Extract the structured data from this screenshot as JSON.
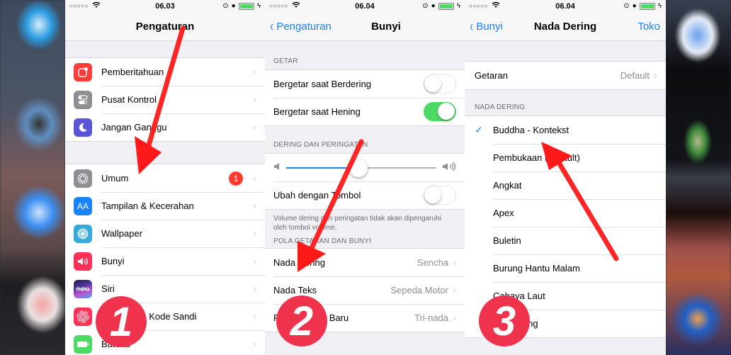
{
  "colors": {
    "ios_blue": "#1a82fb",
    "toggle_on": "#4cd964",
    "badge_red": "#ff3b30",
    "step_badge": "#f0334d",
    "arrow_red": "#ff1a1a"
  },
  "screens": [
    {
      "status": {
        "signal": "○○○○○",
        "wifi": "wifi-icon",
        "time": "06.03",
        "lock": "⊙",
        "alarm": "⏰",
        "bolt": "⚡",
        "battery_level": 1.0
      },
      "nav": {
        "title": "Pengaturan"
      },
      "groups": [
        [
          {
            "label": "Pemberitahuan",
            "icon": "notifications-icon",
            "icon_color": "#fc3d39"
          },
          {
            "label": "Pusat Kontrol",
            "icon": "control-center-icon",
            "icon_color": "#8e8e93"
          },
          {
            "label": "Jangan Ganggu",
            "icon": "do-not-disturb-icon",
            "icon_color": "#5856d6"
          }
        ],
        [
          {
            "label": "Umum",
            "icon": "gear-icon",
            "icon_color": "#8e8e93",
            "badge": "1"
          },
          {
            "label": "Tampilan & Kecerahan",
            "icon": "display-brightness-icon",
            "icon_color": "#1a82fb",
            "icon_text": "AA"
          },
          {
            "label": "Wallpaper",
            "icon": "wallpaper-icon",
            "icon_color": "#35aadc"
          },
          {
            "label": "Bunyi",
            "icon": "sound-icon",
            "icon_color": "#fc3158"
          },
          {
            "label": "Siri",
            "icon": "siri-icon",
            "icon_color": "#2a2a5a"
          },
          {
            "label": "Touch ID & Kode Sandi",
            "icon": "fingerprint-icon",
            "icon_color": "#fc3158"
          },
          {
            "label": "Baterai",
            "icon": "battery-icon",
            "icon_color": "#4cd964"
          }
        ]
      ],
      "step": "1"
    },
    {
      "status": {
        "signal": "○○○○○",
        "wifi": "wifi-icon",
        "time": "06.04",
        "lock": "⊙",
        "alarm": "⏰",
        "bolt": "⚡",
        "battery_level": 1.0
      },
      "nav": {
        "back": "Pengaturan",
        "title": "Bunyi"
      },
      "sections": {
        "getar": {
          "header": "GETAR",
          "rows": [
            {
              "label": "Bergetar saat Berdering",
              "on": false
            },
            {
              "label": "Bergetar saat Hening",
              "on": true
            }
          ]
        },
        "dering": {
          "header": "DERING DAN PERINGATAN",
          "volume": 0.48,
          "toggle_row": {
            "label": "Ubah dengan Tombol",
            "on": false
          },
          "footer": "Volume dering dan peringatan tidak akan dipengaruhi oleh tombol volume."
        },
        "pola": {
          "header": "POLA GETARAN DAN BUNYI",
          "rows": [
            {
              "label": "Nada Dering",
              "value": "Sencha"
            },
            {
              "label": "Nada Teks",
              "value": "Sepeda Motor"
            },
            {
              "label": "Pesan Suara Baru",
              "value": "Tri-nada"
            }
          ]
        }
      },
      "step": "2"
    },
    {
      "status": {
        "signal": "○○○○○",
        "wifi": "wifi-icon",
        "time": "06.04",
        "lock": "⊙",
        "alarm": "⏰",
        "bolt": "⚡",
        "battery_level": 1.0
      },
      "nav": {
        "back": "Bunyi",
        "title": "Nada Dering",
        "right": "Toko"
      },
      "vibration": {
        "label": "Getaran",
        "value": "Default"
      },
      "ringtones": {
        "header": "NADA DERING",
        "items": [
          {
            "label": "Buddha - Kontekst",
            "selected": true
          },
          {
            "label": "Pembukaan (Default)",
            "selected": false
          },
          {
            "label": "Angkat",
            "selected": false
          },
          {
            "label": "Apex",
            "selected": false
          },
          {
            "label": "Buletin",
            "selected": false
          },
          {
            "label": "Burung Hantu Malam",
            "selected": false
          },
          {
            "label": "Cahaya Laut",
            "selected": false
          },
          {
            "label": "Cemerlang",
            "selected": false
          }
        ]
      },
      "step": "3"
    }
  ],
  "glyphs": {
    "chevron": "›",
    "back_chevron": "‹",
    "check": "✓",
    "speaker_low": "◀",
    "speaker_high": "◀))"
  }
}
